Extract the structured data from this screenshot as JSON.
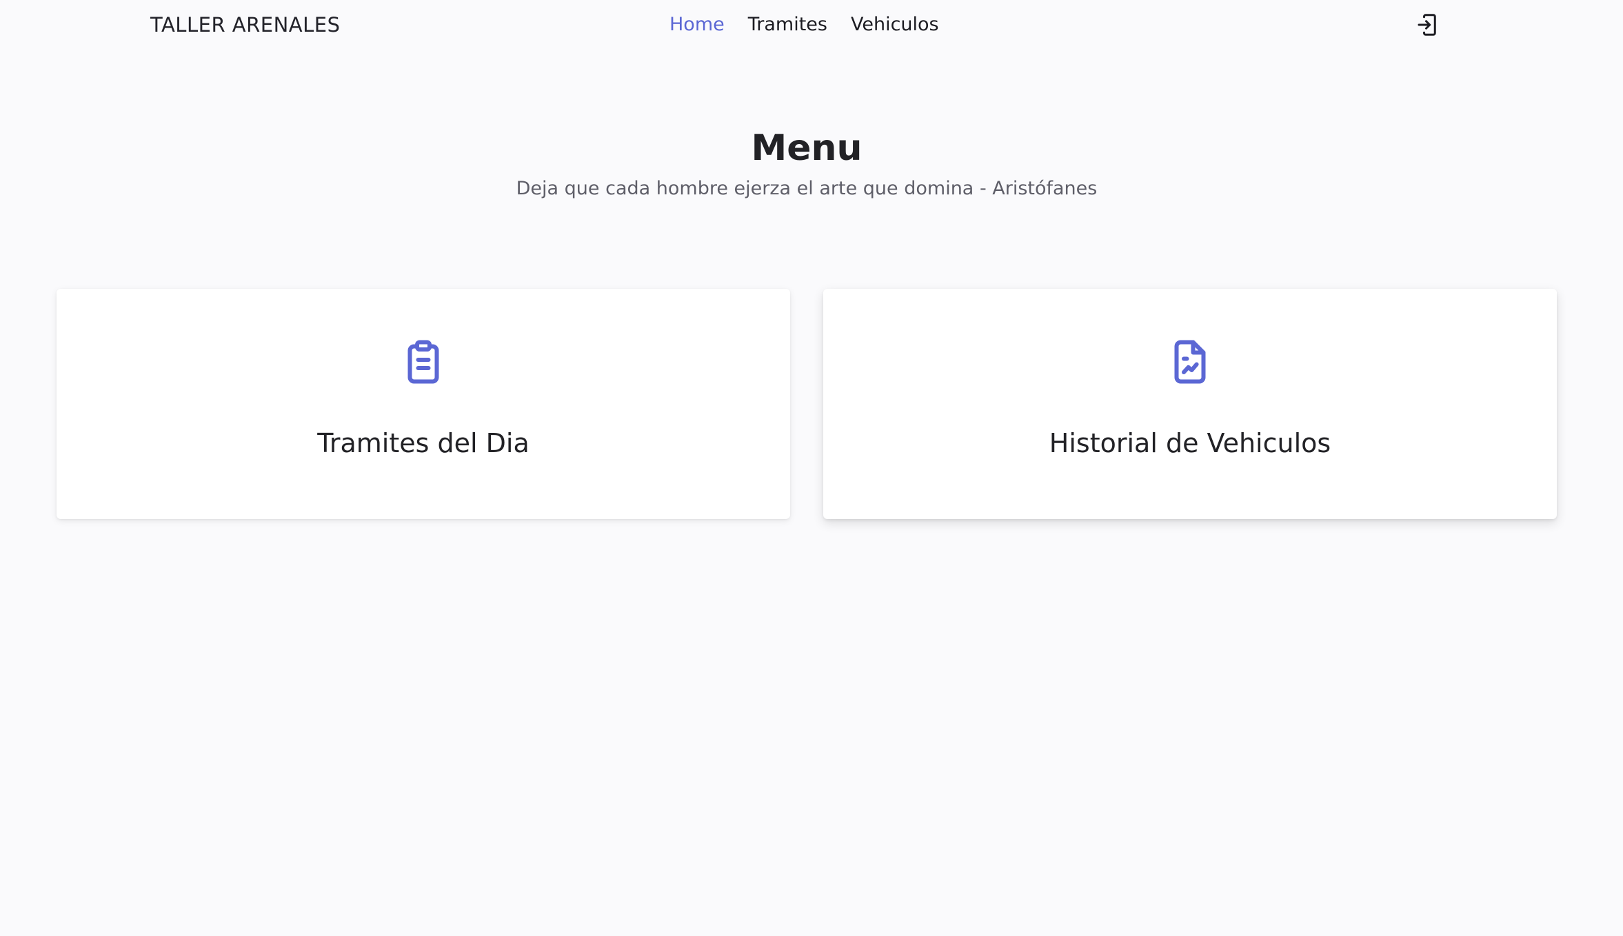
{
  "brand": "TALLER ARENALES",
  "nav": {
    "links": [
      {
        "label": "Home",
        "active": true
      },
      {
        "label": "Tramites",
        "active": false
      },
      {
        "label": "Vehiculos",
        "active": false
      }
    ],
    "logout_icon": "logout-icon"
  },
  "hero": {
    "title": "Menu",
    "subtitle": "Deja que cada hombre ejerza el arte que domina - Aristófanes"
  },
  "cards": [
    {
      "title": "Tramites del Dia",
      "icon": "clipboard-list-icon"
    },
    {
      "title": "Historial de Vehiculos",
      "icon": "file-chart-icon"
    }
  ],
  "colors": {
    "accent": "#5b67d4",
    "background": "#fafafc",
    "card": "#ffffff",
    "text": "#222226",
    "subtext": "#5e5e68"
  }
}
